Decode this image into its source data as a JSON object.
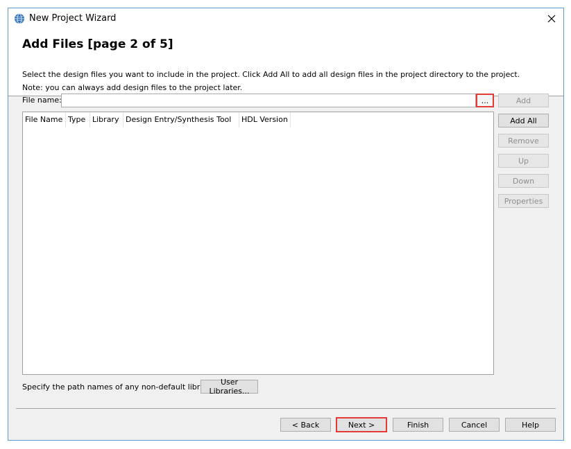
{
  "window": {
    "title": "New Project Wizard",
    "accent_color": "#5a9bd5"
  },
  "header": {
    "heading": "Add Files [page 2 of 5]",
    "description_line1": "Select the design files you want to include in the project. Click Add All to add all design files in the project directory to the project.",
    "description_line2": "Note: you can always add design files to the project later."
  },
  "file_name": {
    "label": "File name:",
    "value": "",
    "browse_label": "..."
  },
  "file_table": {
    "columns": [
      "File Name",
      "Type",
      "Library",
      "Design Entry/Synthesis Tool",
      "HDL Version"
    ],
    "rows": []
  },
  "side_buttons": {
    "add": "Add",
    "add_all": "Add All",
    "remove": "Remove",
    "up": "Up",
    "down": "Down",
    "properties": "Properties"
  },
  "libraries": {
    "label": "Specify the path names of any non-default libraries.",
    "button": "User Libraries..."
  },
  "footer_buttons": {
    "back": "< Back",
    "next": "Next >",
    "finish": "Finish",
    "cancel": "Cancel",
    "help": "Help"
  },
  "highlight_color": "#e53935"
}
